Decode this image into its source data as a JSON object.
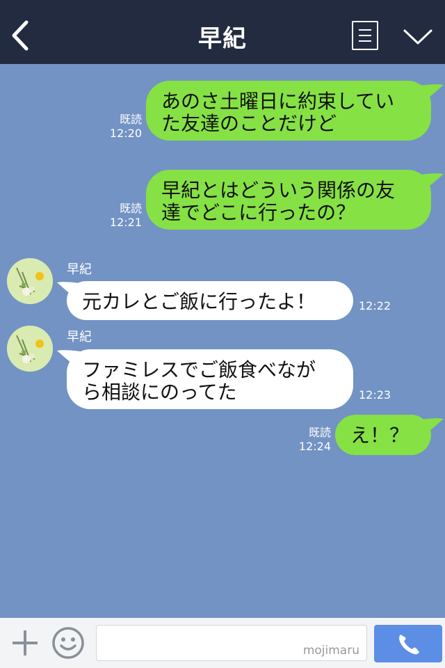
{
  "header": {
    "title": "早紀"
  },
  "icons": {
    "back": "chevron-left-icon",
    "menu": "document-list-icon",
    "collapse": "chevron-down-icon",
    "plus": "plus-icon",
    "emoji": "smiley-icon",
    "call": "phone-icon"
  },
  "colors": {
    "header_bg": "#232b41",
    "chat_bg": "#7293c3",
    "sent_bubble": "#86e145",
    "received_bubble": "#ffffff",
    "call_button": "#5c8ee6"
  },
  "messages": [
    {
      "direction": "sent",
      "text": "あのさ土曜日に約束してい\nた友達のことだけど",
      "read": "既読",
      "time": "12:20"
    },
    {
      "direction": "sent",
      "text": "早紀とはどういう関係の友\n達でどこに行ったの？",
      "read": "既読",
      "time": "12:21"
    },
    {
      "direction": "received",
      "sender": "早紀",
      "text": "元カレとご飯に行ったよ！",
      "time": "12:22"
    },
    {
      "direction": "received",
      "sender": "早紀",
      "text": "ファミレスでご飯食べなが\nら相談にのってた",
      "time": "12:23"
    },
    {
      "direction": "sent",
      "text": "え！？",
      "read": "既読",
      "time": "12:24"
    }
  ],
  "input": {
    "watermark": "mojimaru"
  }
}
